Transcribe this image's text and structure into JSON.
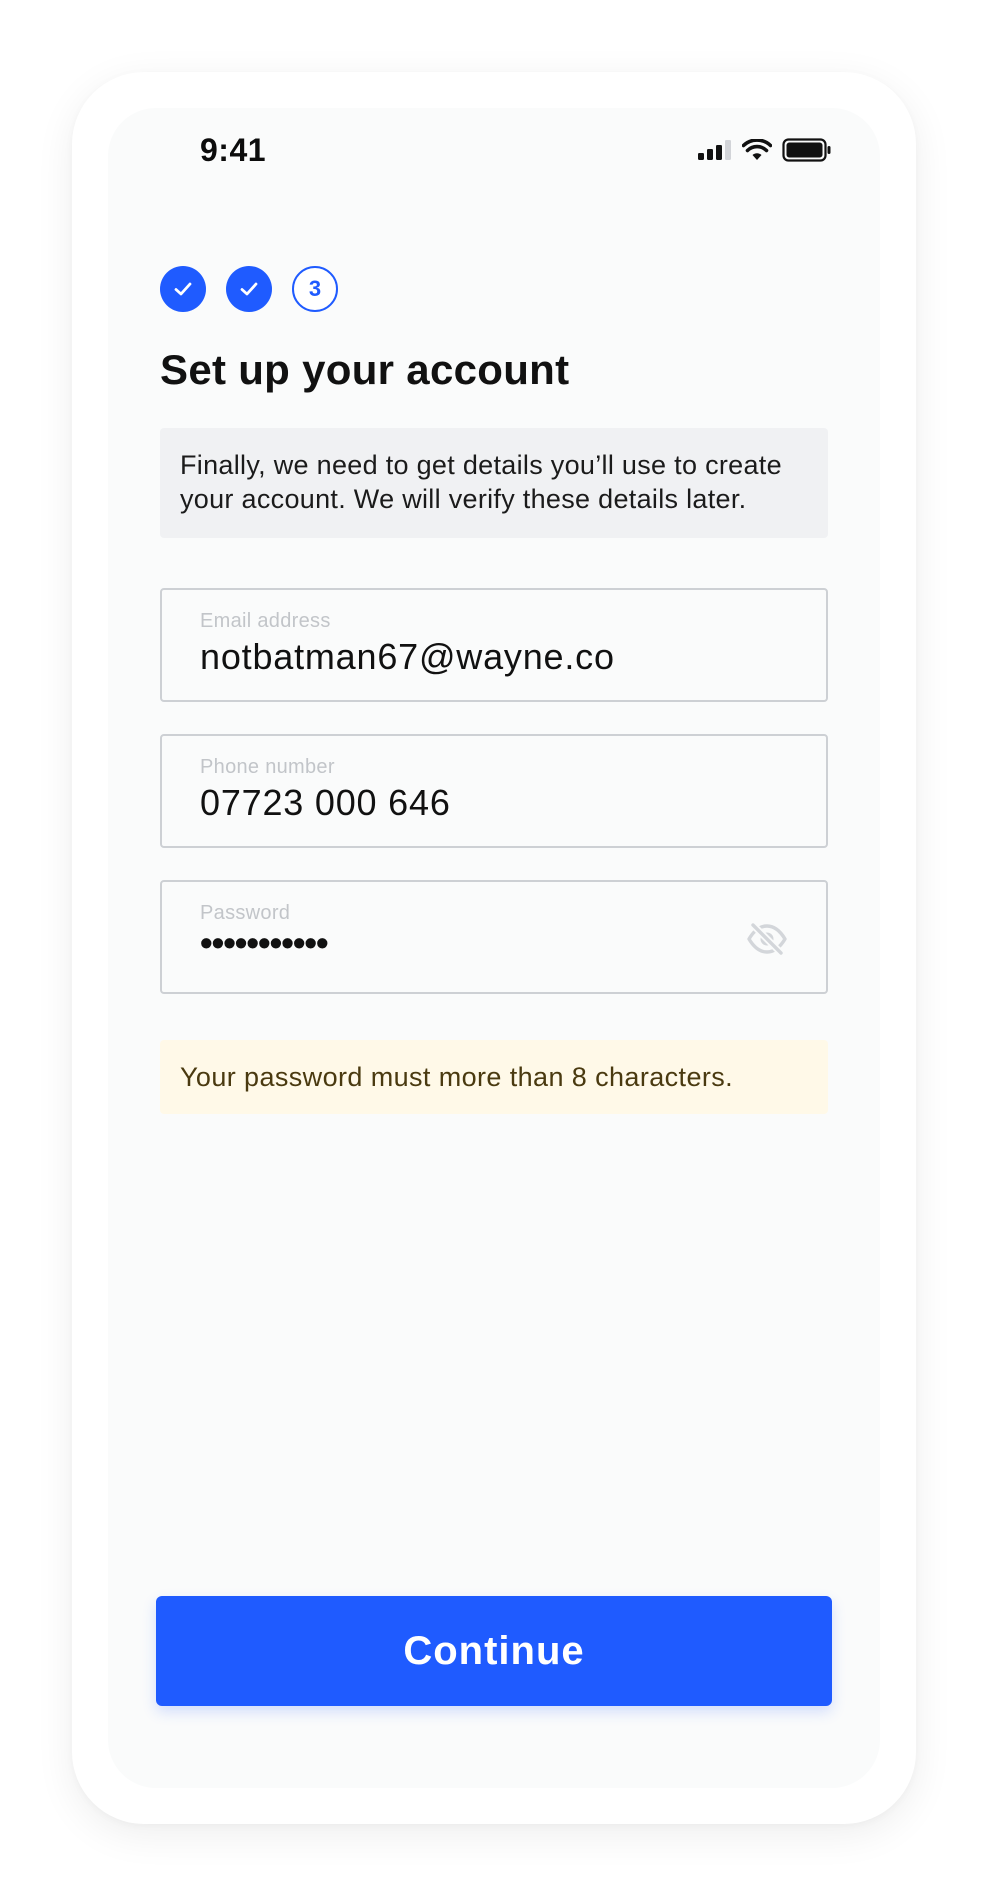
{
  "status_bar": {
    "time": "9:41",
    "icons": [
      "cellular-signal-icon",
      "wifi-icon",
      "battery-icon"
    ]
  },
  "stepper": {
    "steps": [
      {
        "state": "completed",
        "icon": "check-icon"
      },
      {
        "state": "completed",
        "icon": "check-icon"
      },
      {
        "state": "current",
        "label": "3"
      }
    ]
  },
  "page": {
    "title": "Set up your account",
    "info_text": "Finally, we need to get details you’ll use to create your account. We will verify these details later."
  },
  "form": {
    "email": {
      "label": "Email address",
      "value": "notbatman67@wayne.co"
    },
    "phone": {
      "label": "Phone number",
      "value": "07723 000 646"
    },
    "password": {
      "label": "Password",
      "masked_value": "•••••••••••",
      "toggle_icon": "eye-off-icon"
    }
  },
  "validation": {
    "password_warning": "Your password must more than 8 characters."
  },
  "actions": {
    "continue_label": "Continue"
  },
  "colors": {
    "primary": "#1f5bff",
    "screen_background": "#fafbfb",
    "info_background": "#f0f1f3",
    "warning_background": "#fff9e8",
    "warning_text": "#4a3a10"
  }
}
